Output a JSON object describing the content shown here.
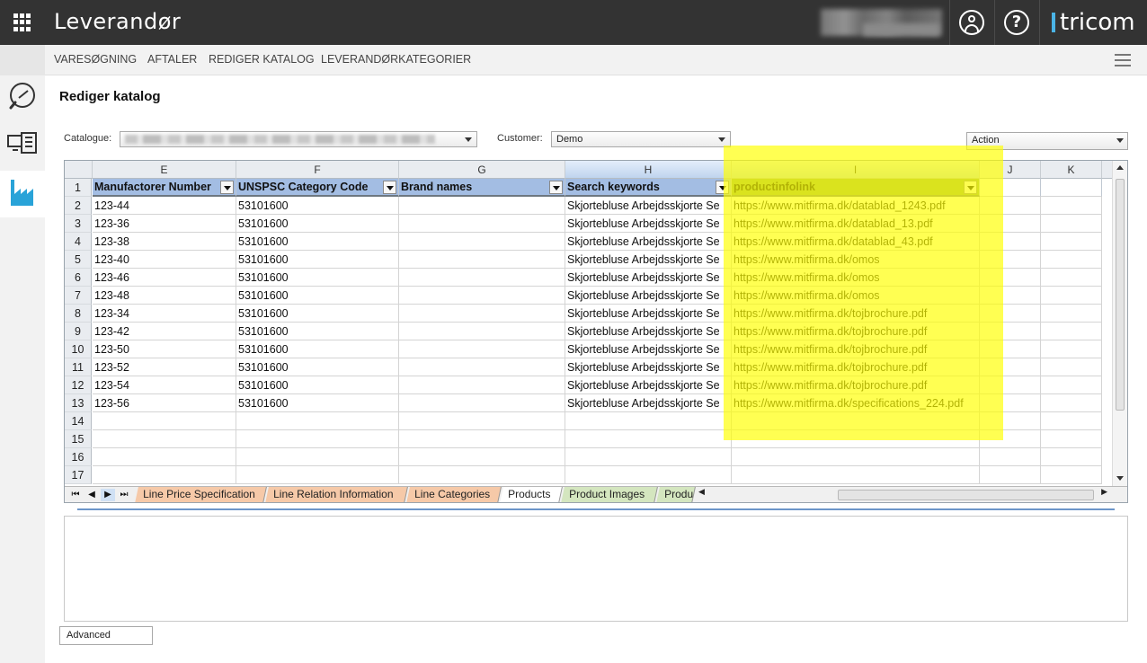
{
  "app": {
    "title": "Leverandør",
    "logo": "tricom"
  },
  "topbar_icons": [
    "apps-grid-icon",
    "user-account-icon",
    "help-icon"
  ],
  "subnav": {
    "items": [
      "VARESØGNING",
      "AFTALER",
      "REDIGER KATALOG",
      "LEVERANDØRKATEGORIER"
    ]
  },
  "sidebar": {
    "items": [
      "search-icon",
      "catalog-list-icon",
      "factory-icon"
    ],
    "active_index": 2,
    "active_color": "#29a3d8"
  },
  "page": {
    "title": "Rediger katalog"
  },
  "filters": {
    "catalogue_label": "Catalogue:",
    "customer_label": "Customer:",
    "customer_value": "Demo",
    "action_label": "Action"
  },
  "sheet": {
    "columns": [
      "E",
      "F",
      "G",
      "H",
      "I",
      "J",
      "K"
    ],
    "headers": [
      "Manufactorer Number",
      "UNSPSC Category Code",
      "Brand names",
      "Search keywords",
      "productinfolink"
    ],
    "row_numbers": [
      "1",
      "2",
      "3",
      "4",
      "5",
      "6",
      "7",
      "8",
      "9",
      "10",
      "11",
      "12",
      "13",
      "14",
      "15",
      "16",
      "17"
    ],
    "rows": [
      [
        "123-44",
        "53101600",
        "",
        "Skjortebluse Arbejdsskjorte Se",
        "https://www.mitfirma.dk/datablad_1243.pdf"
      ],
      [
        "123-36",
        "53101600",
        "",
        "Skjortebluse Arbejdsskjorte Se",
        "https://www.mitfirma.dk/datablad_13.pdf"
      ],
      [
        "123-38",
        "53101600",
        "",
        "Skjortebluse Arbejdsskjorte Se",
        "https://www.mitfirma.dk/datablad_43.pdf"
      ],
      [
        "123-40",
        "53101600",
        "",
        "Skjortebluse Arbejdsskjorte Se",
        "https://www.mitfirma.dk/omos"
      ],
      [
        "123-46",
        "53101600",
        "",
        "Skjortebluse Arbejdsskjorte Se",
        "https://www.mitfirma.dk/omos"
      ],
      [
        "123-48",
        "53101600",
        "",
        "Skjortebluse Arbejdsskjorte Se",
        "https://www.mitfirma.dk/omos"
      ],
      [
        "123-34",
        "53101600",
        "",
        "Skjortebluse Arbejdsskjorte Se",
        "https://www.mitfirma.dk/tojbrochure.pdf"
      ],
      [
        "123-42",
        "53101600",
        "",
        "Skjortebluse Arbejdsskjorte Se",
        "https://www.mitfirma.dk/tojbrochure.pdf"
      ],
      [
        "123-50",
        "53101600",
        "",
        "Skjortebluse Arbejdsskjorte Se",
        "https://www.mitfirma.dk/tojbrochure.pdf"
      ],
      [
        "123-52",
        "53101600",
        "",
        "Skjortebluse Arbejdsskjorte Se",
        "https://www.mitfirma.dk/tojbrochure.pdf"
      ],
      [
        "123-54",
        "53101600",
        "",
        "Skjortebluse Arbejdsskjorte Se",
        "https://www.mitfirma.dk/tojbrochure.pdf"
      ],
      [
        "123-56",
        "53101600",
        "",
        "Skjortebluse Arbejdsskjorte Se",
        "https://www.mitfirma.dk/specifications_224.pdf"
      ]
    ],
    "tabs": [
      {
        "label": "Line Price Specification",
        "color": "#f6c9a8"
      },
      {
        "label": "Line Relation Information",
        "color": "#f6c9a8"
      },
      {
        "label": "Line Categories",
        "color": "#f6c9a8"
      },
      {
        "label": "Products",
        "color": "#ffffff"
      },
      {
        "label": "Product Images",
        "color": "#d4e6bf"
      },
      {
        "label": "Produ",
        "color": "#d4e6bf"
      }
    ],
    "header_colors": {
      "blue": "#a3bde3",
      "green": "#8da85f"
    },
    "highlight_color": "#ffff00"
  },
  "footer": {
    "advanced_label": "Advanced"
  }
}
